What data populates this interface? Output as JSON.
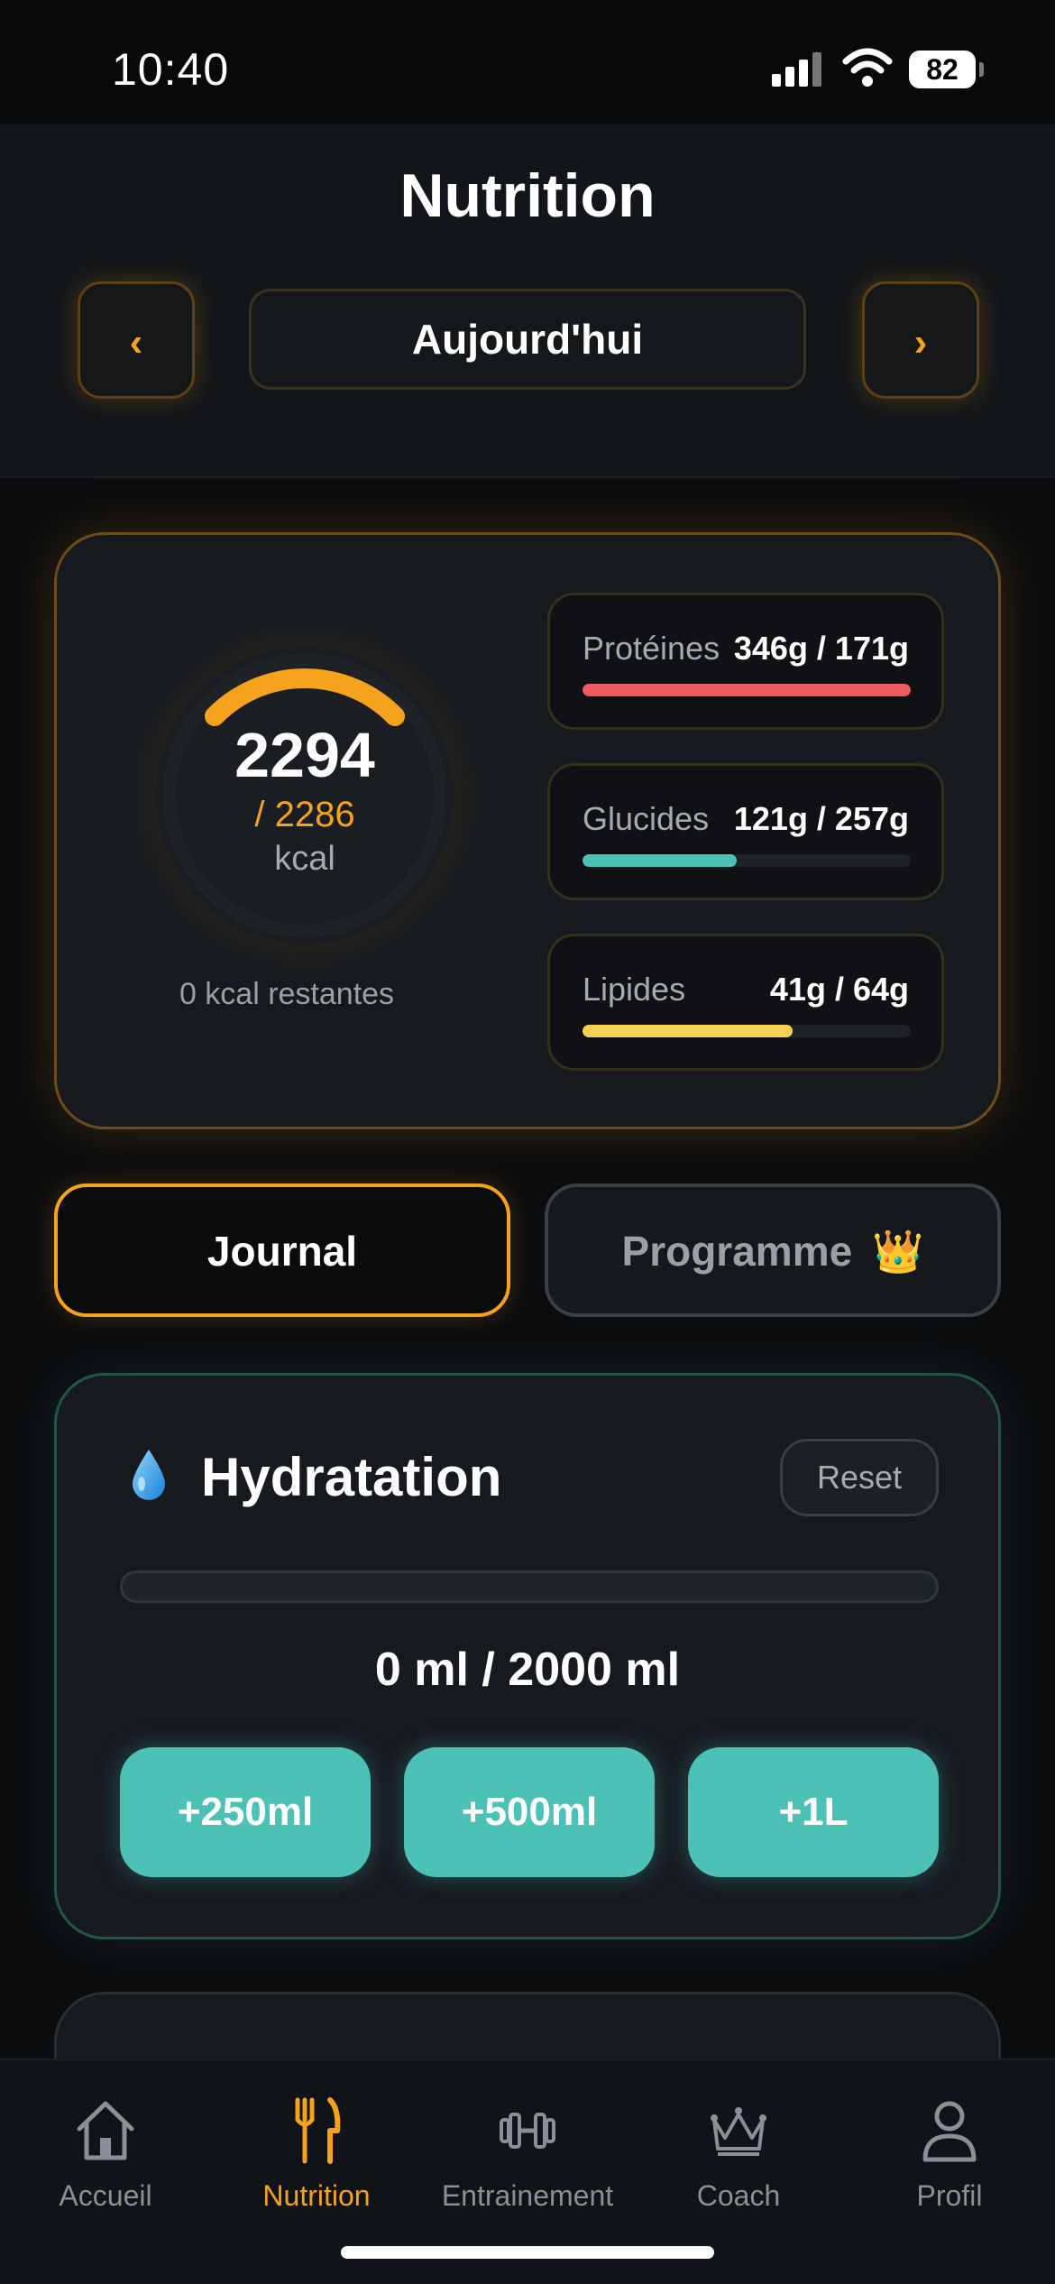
{
  "status": {
    "time": "10:40",
    "battery": "82"
  },
  "header": {
    "title": "Nutrition",
    "date_label": "Aujourd'hui",
    "prev_symbol": "‹",
    "next_symbol": "›"
  },
  "summary": {
    "consumed": "2294",
    "goal": "/ 2286",
    "unit": "kcal",
    "remaining": "0 kcal restantes",
    "progress_fraction": 1.0,
    "macros": [
      {
        "name": "Protéines",
        "value": "346g / 171g",
        "fraction": 1.0,
        "color": "#ef5a5f"
      },
      {
        "name": "Glucides",
        "value": "121g / 257g",
        "fraction": 0.47,
        "color": "#4cc1b6"
      },
      {
        "name": "Lipides",
        "value": "41g / 64g",
        "fraction": 0.64,
        "color": "#f7d154"
      }
    ]
  },
  "tabs": {
    "journal": "Journal",
    "programme": "Programme",
    "programme_badge": "👑"
  },
  "hydration": {
    "title": "Hydratation",
    "reset": "Reset",
    "value": "0 ml / 2000 ml",
    "fraction": 0,
    "buttons": [
      "+250ml",
      "+500ml",
      "+1L"
    ]
  },
  "tabbar": [
    {
      "label": "Accueil",
      "icon": "home-icon"
    },
    {
      "label": "Nutrition",
      "icon": "fork-knife-icon"
    },
    {
      "label": "Entrainement",
      "icon": "dumbbell-icon"
    },
    {
      "label": "Coach",
      "icon": "crown-icon"
    },
    {
      "label": "Profil",
      "icon": "person-icon"
    }
  ],
  "colors": {
    "accent": "#f5a21c",
    "water": "#4cc1b6",
    "background": "#0b0c0e"
  }
}
